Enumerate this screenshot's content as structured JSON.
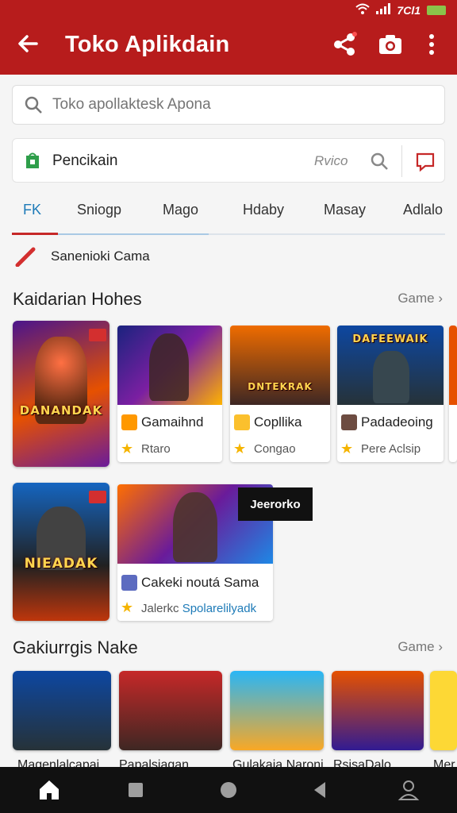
{
  "status": {
    "time": "7Cl1"
  },
  "appbar": {
    "title": "Toko Aplikdain",
    "bg": "#b71c1c"
  },
  "search": {
    "placeholder": "Toko apollaktesk Apona"
  },
  "bar2": {
    "label": "Pencikain",
    "side": "Rvico"
  },
  "tabs": [
    "FK",
    "Sniogp",
    "Mago",
    "Hdaby",
    "Masay",
    "Adlalo"
  ],
  "promo": {
    "text": "Sanenioki Cama"
  },
  "section1": {
    "title": "Kaidarian Hohes",
    "more": "Game"
  },
  "section2": {
    "title": "Gakiurrgis Nake",
    "more": "Game"
  },
  "cards_row1": [
    {
      "name": "Gamaihnd",
      "sub": "Rtaro"
    },
    {
      "name": "Copllika",
      "sub": "Congao"
    },
    {
      "name": "Padadeoing",
      "sub": "Pere Aclsip"
    }
  ],
  "covers": {
    "big1": "DANANDAK",
    "big2": "NIEADAK",
    "c3": "DNTEKRAK",
    "c4": "DAFEEWAIK",
    "tile_logo": "Jeerorko"
  },
  "wide_card": {
    "name": "Cakeki noutá Sama",
    "sub": "Jalerkc",
    "link": "Spolarelilyadk"
  },
  "row3_labels": [
    "Magenlalcapai",
    "Papalsiagan",
    "Gulakaia Naroni",
    "RsisaDalo",
    "Mer"
  ],
  "colors": {
    "accent": "#b71c1c",
    "tab_active": "#1e7bb8"
  }
}
